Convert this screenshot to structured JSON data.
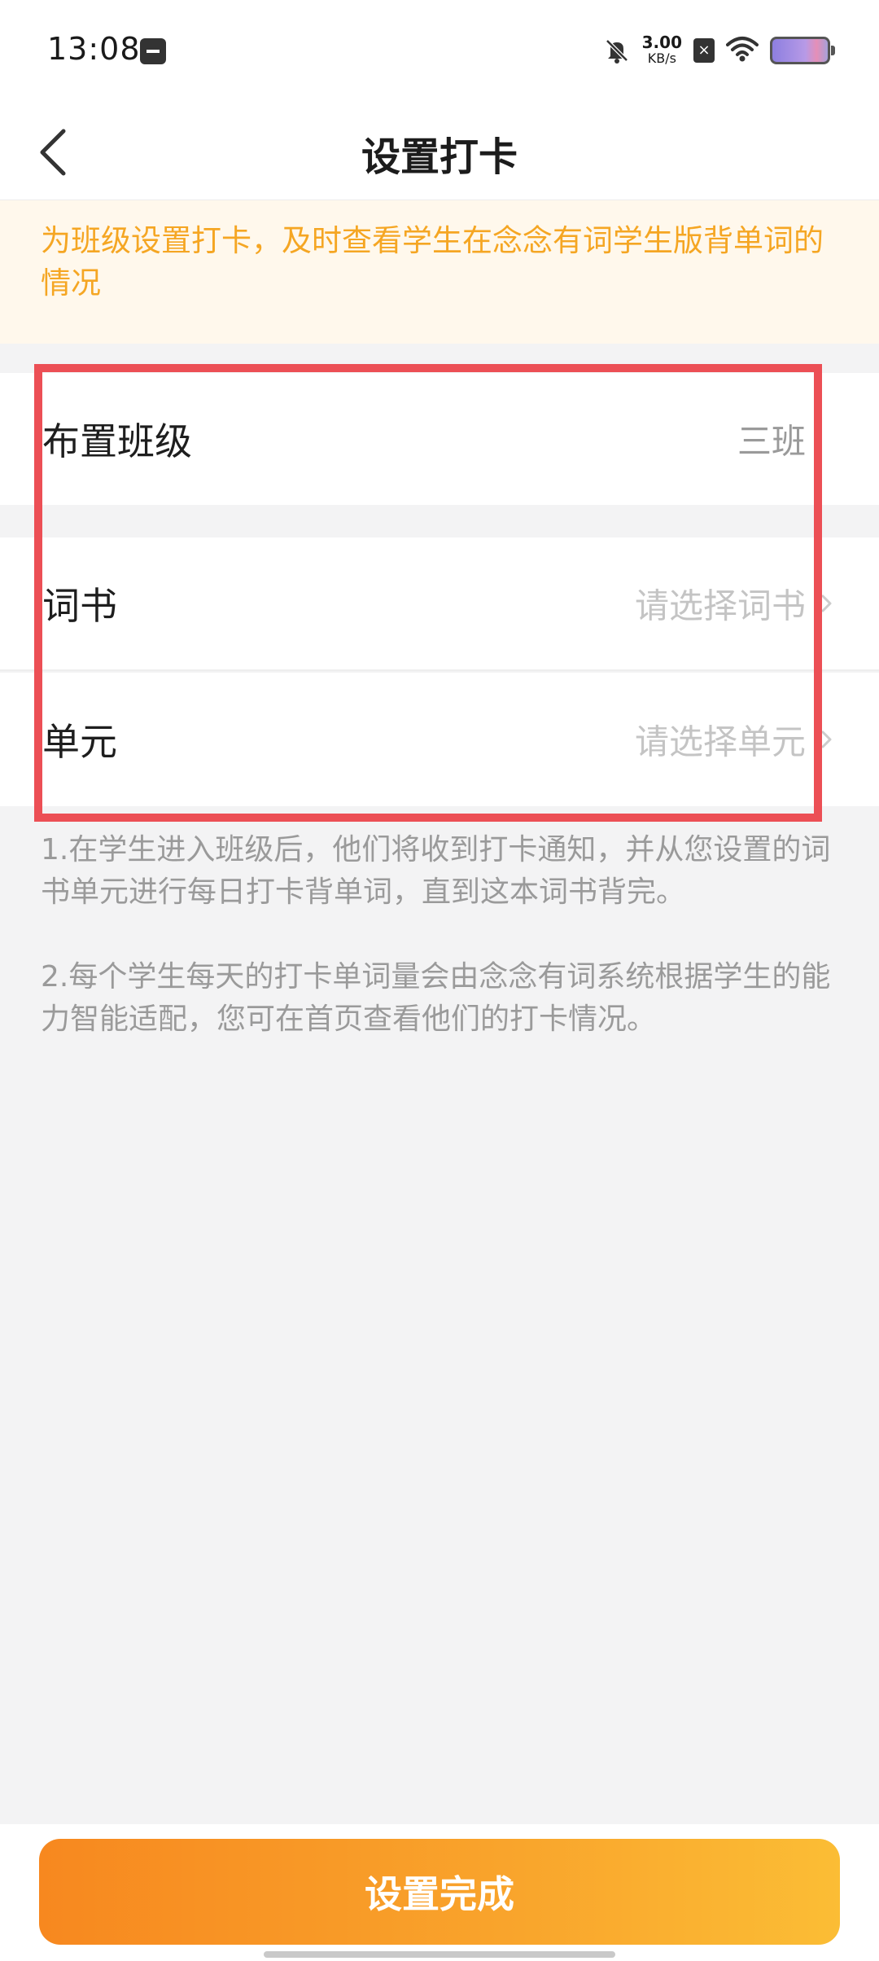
{
  "status_bar": {
    "time": "13:08",
    "net_speed_value": "3.00",
    "net_speed_unit": "KB/s",
    "sim_label": "×",
    "icons": [
      "calendar-icon",
      "bell-muted-icon",
      "sim-x-icon",
      "wifi-icon",
      "battery-icon"
    ]
  },
  "nav": {
    "title": "设置打卡",
    "back_icon": "chevron-left-icon"
  },
  "notice": {
    "text": "为班级设置打卡，及时查看学生在念念有词学生版背单词的情况",
    "color": "#f5a623"
  },
  "form": {
    "class_row": {
      "label": "布置班级",
      "value": "三班"
    },
    "book_row": {
      "label": "词书",
      "placeholder": "请选择词书"
    },
    "unit_row": {
      "label": "单元",
      "placeholder": "请选择单元"
    },
    "highlight_color": "#ec4f55"
  },
  "tips": [
    "1.在学生进入班级后，他们将收到打卡通知，并从您设置的词书单元进行每日打卡背单词，直到这本词书背完。",
    "2.每个学生每天的打卡单词量会由念念有词系统根据学生的能力智能适配，您可在首页查看他们的打卡情况。"
  ],
  "footer": {
    "done_label": "设置完成",
    "button_gradient": [
      "#f7881f",
      "#fbbd35"
    ]
  }
}
